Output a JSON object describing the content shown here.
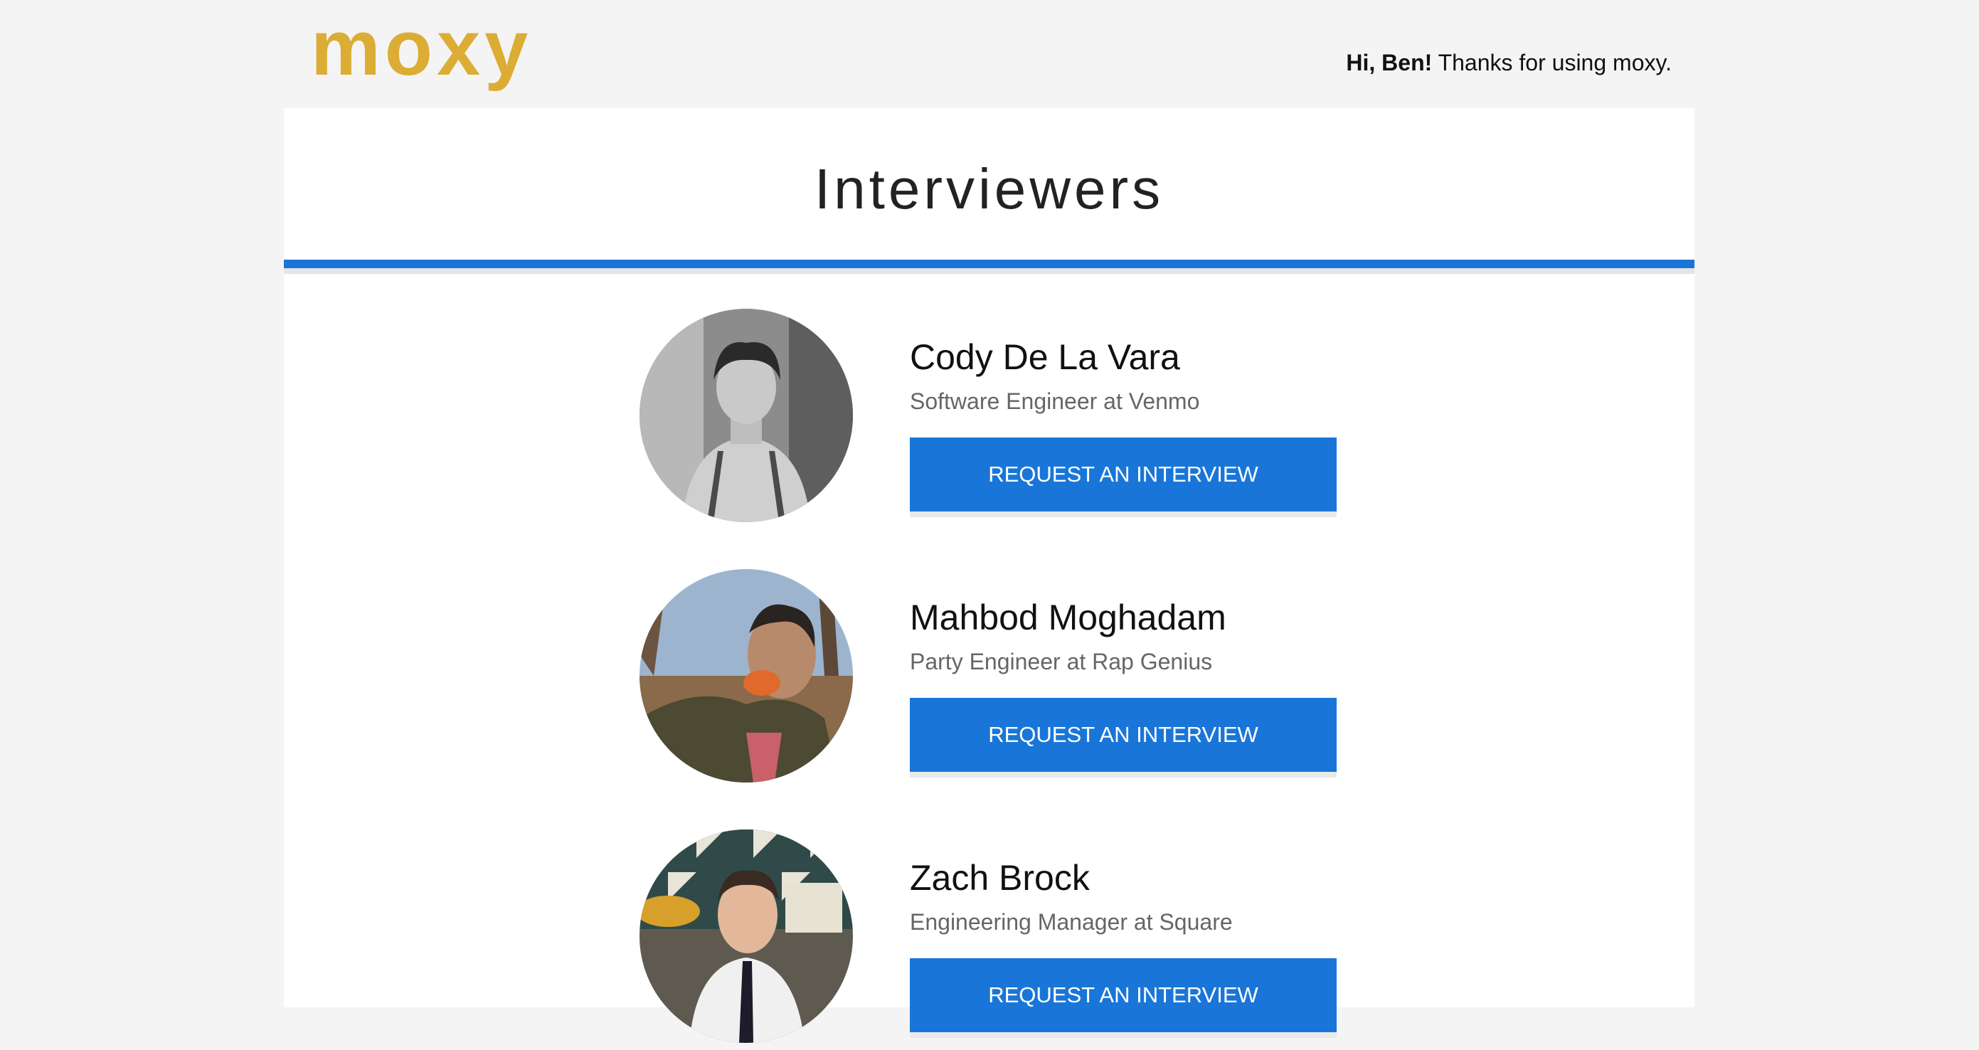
{
  "header": {
    "logo": "moxy",
    "greeting_bold": "Hi, Ben!",
    "greeting_rest": " Thanks for using moxy."
  },
  "page": {
    "title": "Interviewers"
  },
  "interviewers": [
    {
      "name": "Cody De La Vara",
      "role": "Software Engineer at Venmo",
      "button": "REQUEST AN INTERVIEW"
    },
    {
      "name": "Mahbod Moghadam",
      "role": "Party Engineer at Rap Genius",
      "button": "REQUEST AN INTERVIEW"
    },
    {
      "name": "Zach Brock",
      "role": "Engineering Manager at Square",
      "button": "REQUEST AN INTERVIEW"
    }
  ],
  "colors": {
    "accent": "#1976d8",
    "logo": "#dbad35",
    "background": "#f4f4f4"
  }
}
